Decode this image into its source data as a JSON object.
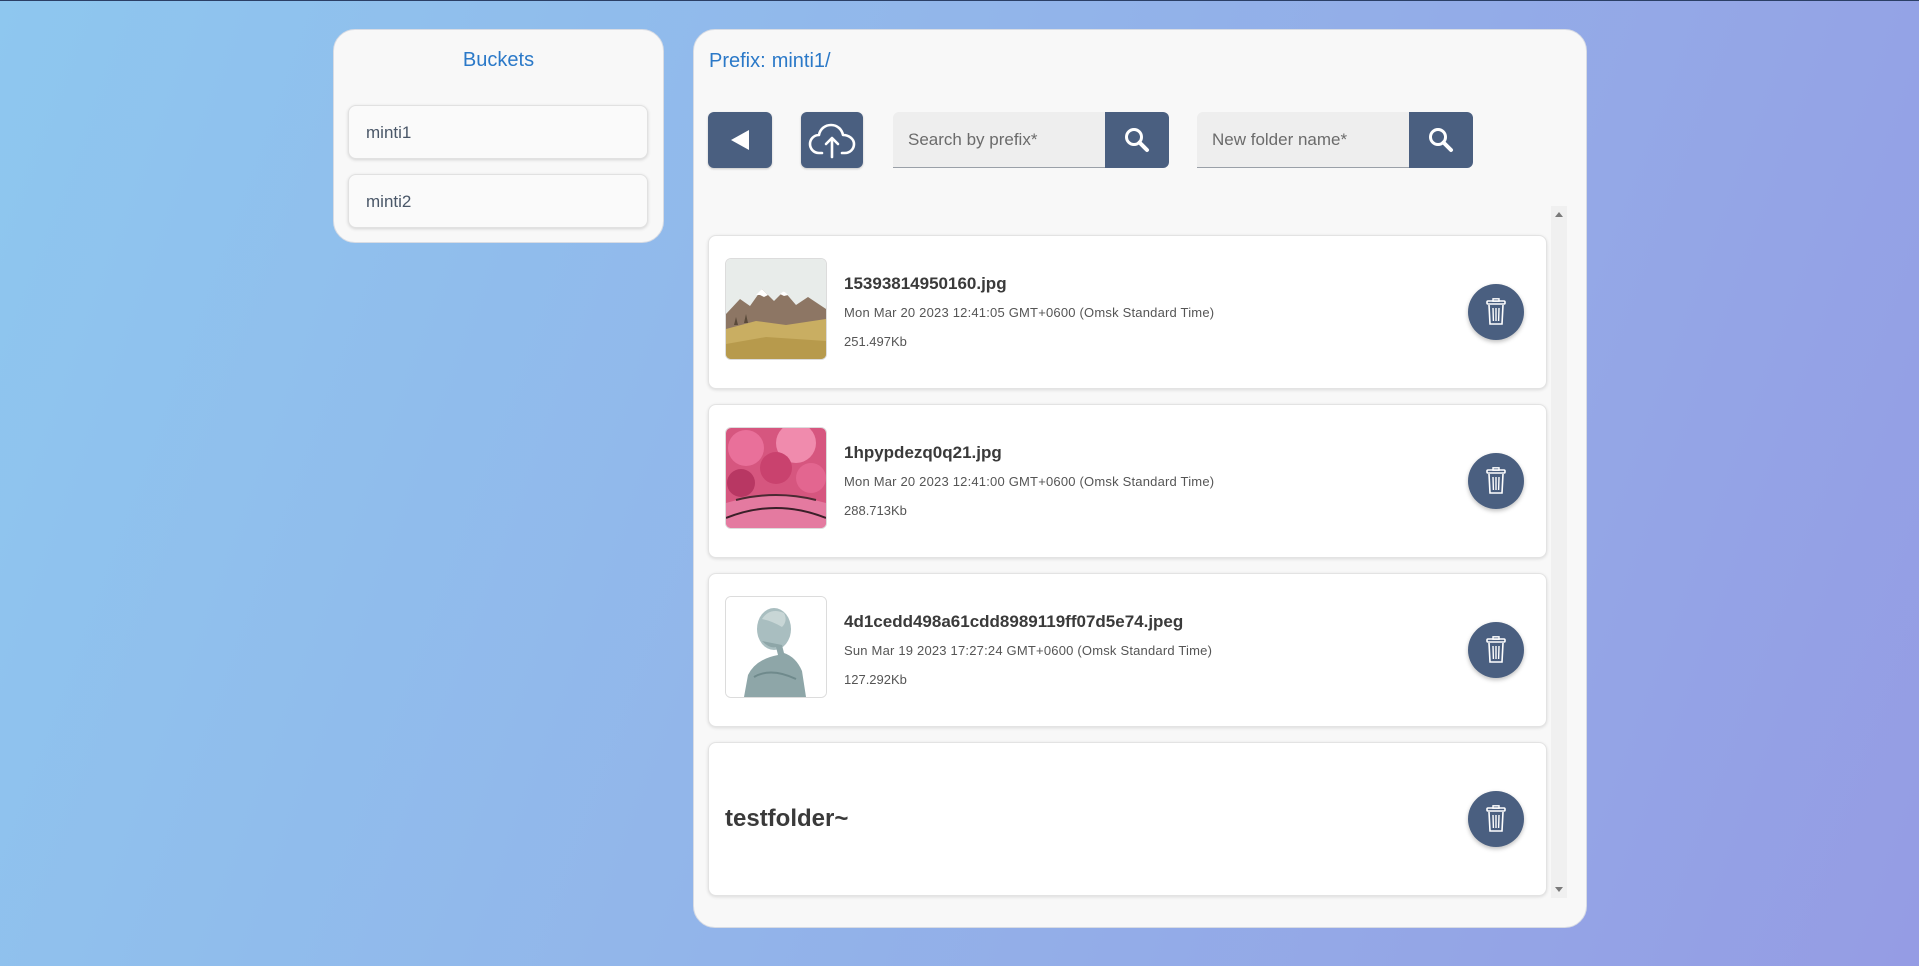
{
  "buckets": {
    "title": "Buckets",
    "items": [
      {
        "label": "minti1"
      },
      {
        "label": "minti2"
      }
    ]
  },
  "main": {
    "prefix_label": "Prefix:",
    "prefix_value": "minti1/",
    "search_placeholder": "Search by prefix*",
    "folder_placeholder": "New folder name*",
    "files": [
      {
        "name": "15393814950160.jpg",
        "date": "Mon Mar 20 2023 12:41:05 GMT+0600 (Omsk Standard Time)",
        "size": "251.497Kb"
      },
      {
        "name": "1hpypdezq0q21.jpg",
        "date": "Mon Mar 20 2023 12:41:00 GMT+0600 (Omsk Standard Time)",
        "size": "288.713Kb"
      },
      {
        "name": "4d1cedd498a61cdd8989119ff07d5e74.jpeg",
        "date": "Sun Mar 19 2023 17:27:24 GMT+0600 (Omsk Standard Time)",
        "size": "127.292Kb"
      }
    ],
    "folders": [
      {
        "name": "testfolder~"
      }
    ]
  },
  "icons": {
    "back": "back-arrow-icon",
    "upload": "cloud-upload-icon",
    "search": "search-icon",
    "delete": "trash-icon"
  },
  "colors": {
    "accent": "#2b79c8",
    "button": "#4a5f80",
    "panel": "#f8f8f8"
  }
}
